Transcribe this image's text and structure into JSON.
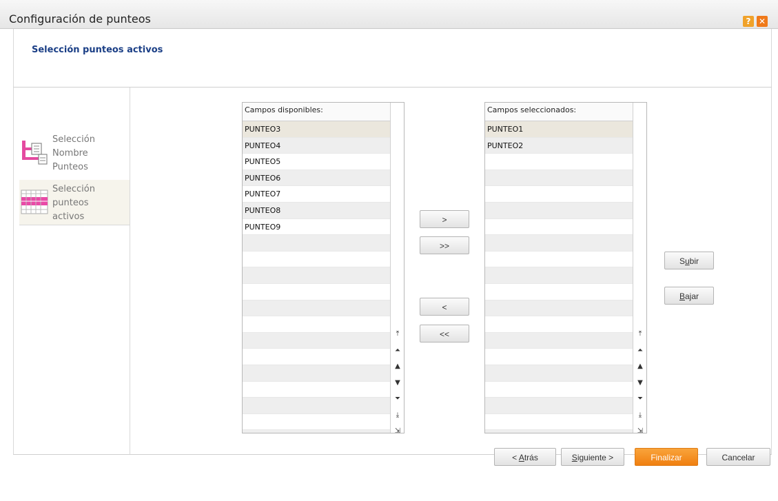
{
  "window": {
    "title": "Configuración de punteos",
    "help_glyph": "?",
    "close_glyph": "✕"
  },
  "header": {
    "subtitle": "Selección punteos activos"
  },
  "nav": {
    "items": [
      {
        "label": "Selección\nNombre\nPunteos",
        "icon": "tree-document-icon",
        "active": false
      },
      {
        "label": "Selección\npunteos\nactivos",
        "icon": "grid-table-icon",
        "active": true
      }
    ]
  },
  "available": {
    "header": "Campos disponibles:",
    "rows": [
      "PUNTEO3",
      "PUNTEO4",
      "PUNTEO5",
      "PUNTEO6",
      "PUNTEO7",
      "PUNTEO8",
      "PUNTEO9",
      "",
      "",
      "",
      "",
      "",
      "",
      "",
      "",
      "",
      "",
      "",
      "",
      ""
    ],
    "selected_row": "PUNTEO3"
  },
  "selected": {
    "header": "Campos seleccionados:",
    "rows": [
      "PUNTEO1",
      "PUNTEO2",
      "",
      "",
      "",
      "",
      "",
      "",
      "",
      "",
      "",
      "",
      "",
      "",
      "",
      "",
      "",
      "",
      "",
      ""
    ],
    "selected_row": "PUNTEO1"
  },
  "transfer": {
    "add": ">",
    "add_all": ">>",
    "remove": "<",
    "remove_all": "<<"
  },
  "order": {
    "up_pre": "S",
    "up_u": "u",
    "up_post": "bir",
    "down_pre": "",
    "down_u": "B",
    "down_post": "ajar"
  },
  "scroll_glyphs": [
    "⤒",
    "⏶",
    "▲",
    "▼",
    "⏷",
    "⤓",
    "⇲"
  ],
  "footer": {
    "back_pre": "< ",
    "back_u": "A",
    "back_post": "trás",
    "next_pre": "",
    "next_u": "S",
    "next_post": "iguiente >",
    "finish": "Finalizar",
    "cancel": "Cancelar"
  },
  "colors": {
    "accent_title": "#1b3f86",
    "finish_button": "#f28a1c",
    "selected_row": "#ebe7dd"
  }
}
